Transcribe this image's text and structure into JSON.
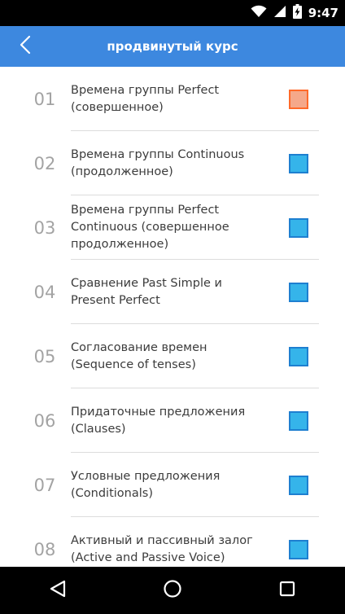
{
  "status_bar": {
    "time": "9:47"
  },
  "app_bar": {
    "title": "продвинутый курс"
  },
  "colors": {
    "accent": "#3d88df",
    "status_in_progress": "#f5a88a",
    "status_in_progress_border": "#ff6a2a",
    "status_default": "#35b4ea",
    "status_default_border": "#1e7fd0"
  },
  "lessons": [
    {
      "number": "01",
      "title": "Времена группы Perfect\n(совершенное)",
      "status": "in-progress"
    },
    {
      "number": "02",
      "title": "Времена группы Continuous\n(продолженное)",
      "status": "default"
    },
    {
      "number": "03",
      "title": "Времена группы Perfect\nContinuous (совершенное\nпродолженное)",
      "status": "default"
    },
    {
      "number": "04",
      "title": "Сравнение Past Simple и\nPresent Perfect",
      "status": "default"
    },
    {
      "number": "05",
      "title": "Согласование времен\n(Sequence of tenses)",
      "status": "default"
    },
    {
      "number": "06",
      "title": "Придаточные предложения\n(Clauses)",
      "status": "default"
    },
    {
      "number": "07",
      "title": "Условные предложения\n(Conditionals)",
      "status": "default"
    },
    {
      "number": "08",
      "title": "Активный и пассивный залог\n(Active and Passive Voice)",
      "status": "default"
    }
  ],
  "icons": {
    "back": "chevron-left-icon",
    "wifi": "wifi-icon",
    "signal": "signal-icon",
    "battery": "battery-charging-icon",
    "nav_back": "nav-back-icon",
    "nav_home": "nav-home-icon",
    "nav_recents": "nav-recents-icon"
  }
}
